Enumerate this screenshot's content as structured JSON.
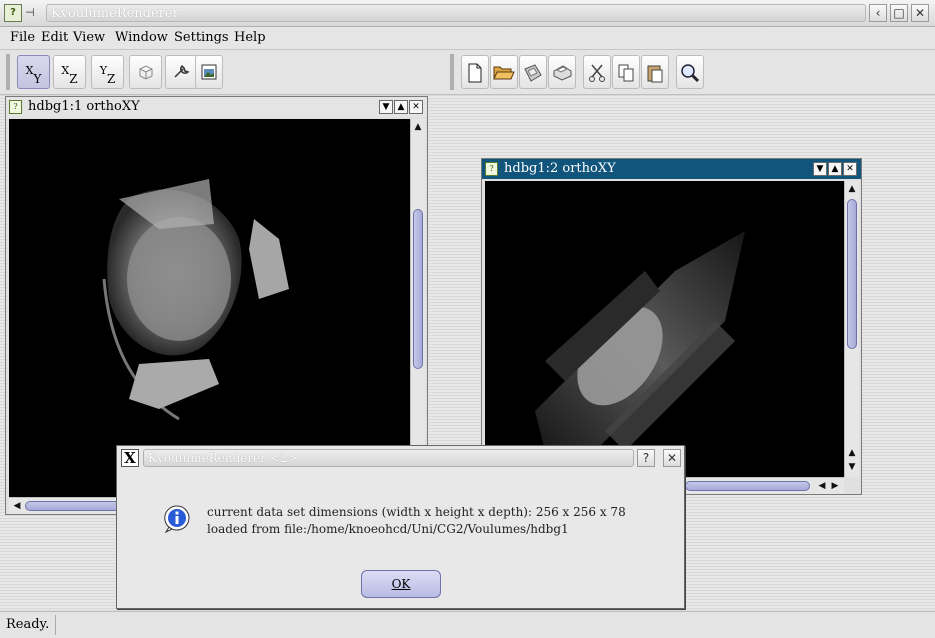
{
  "window": {
    "title": "KvoulumeRenderer",
    "icon_glyph": "?",
    "pin_glyph": "⊣",
    "help_glyph": "‹",
    "max_glyph": "□",
    "close_glyph": "✕"
  },
  "menu": {
    "items": [
      {
        "label": "File"
      },
      {
        "label": "Edit"
      },
      {
        "label": "View"
      },
      {
        "label": "Window"
      },
      {
        "label": "Settings"
      },
      {
        "label": "Help"
      }
    ]
  },
  "toolbar": {
    "view_xy": {
      "top": "X",
      "sub": "Y"
    },
    "view_xz": {
      "top": "X",
      "sub": "Z"
    },
    "view_yz": {
      "top": "Y",
      "sub": "Z"
    },
    "icons": [
      "cube-icon",
      "wrench-icon",
      "export-image-icon",
      "new-file-icon",
      "open-folder-icon",
      "save-icon",
      "print-icon",
      "cut-icon",
      "copy-icon",
      "paste-icon",
      "zoom-icon"
    ]
  },
  "subwindows": {
    "left": {
      "title": "hdbg1:1 orthoXY",
      "active": false
    },
    "right": {
      "title": "hdbg1:2 orthoXY",
      "active": true
    }
  },
  "colors": {
    "active_title": "#11557c",
    "inactive_title": "#e4e4e4",
    "scroll_thumb": "#a6aad8"
  },
  "status": {
    "text": "Ready."
  },
  "dialog": {
    "title": "KvoulumeRenderer <2>",
    "help_glyph": "?",
    "close_glyph": "✕",
    "icon": "info-icon",
    "line1": "current data set dimensions (width x height x depth): 256 x 256 x 78",
    "line2": "loaded from file:/home/knoeohcd/Uni/CG2/Voulumes/hdbg1",
    "ok_label": "OK"
  }
}
